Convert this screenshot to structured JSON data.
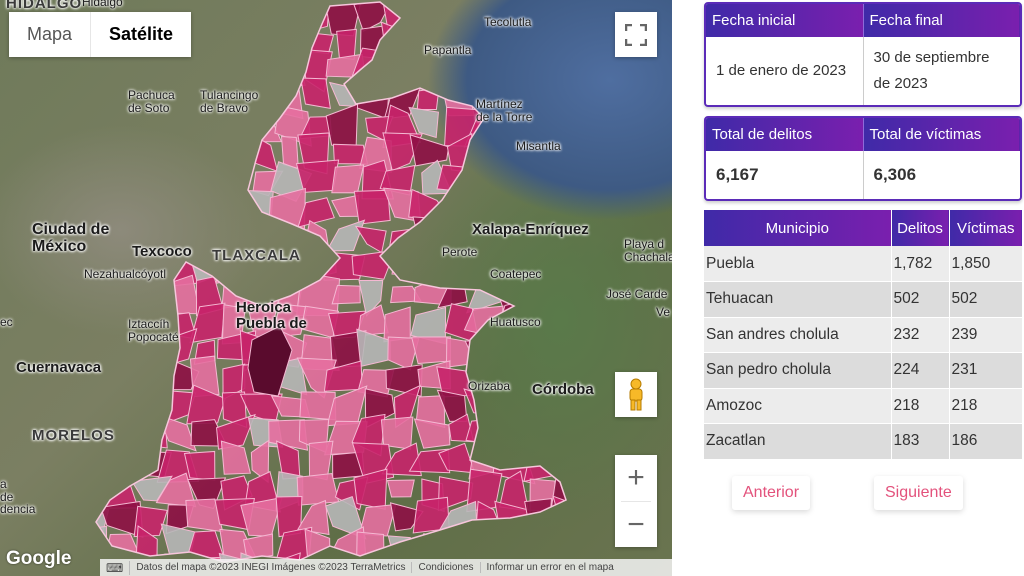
{
  "map": {
    "type_buttons": {
      "map": "Mapa",
      "satellite": "Satélite"
    },
    "labels": [
      {
        "text": "Hidalgo",
        "cls": ""
      },
      {
        "text": "HIDALGO",
        "cls": "state"
      },
      {
        "text": "Tecolutla",
        "cls": ""
      },
      {
        "text": "Papantla",
        "cls": ""
      },
      {
        "text": "Pachuca\nde Soto",
        "cls": ""
      },
      {
        "text": "Tulancingo\nde Bravo",
        "cls": ""
      },
      {
        "text": "Martínez\nde la Torre",
        "cls": ""
      },
      {
        "text": "Misantla",
        "cls": ""
      },
      {
        "text": "Ciudad de\nMéxico",
        "cls": "big"
      },
      {
        "text": "Texcoco",
        "cls": "city"
      },
      {
        "text": "TLAXCALA",
        "cls": "state"
      },
      {
        "text": "Xalapa-Enríquez",
        "cls": "city"
      },
      {
        "text": "Playa d\nChachalac",
        "cls": ""
      },
      {
        "text": "Perote",
        "cls": ""
      },
      {
        "text": "Nezahualcóyotl",
        "cls": ""
      },
      {
        "text": "Coatepec",
        "cls": ""
      },
      {
        "text": "José Carde",
        "cls": ""
      },
      {
        "text": "Heroica\nPuebla de",
        "cls": "city"
      },
      {
        "text": "Iztaccíh\nPopocaté",
        "cls": ""
      },
      {
        "text": "Huatusco",
        "cls": ""
      },
      {
        "text": "Ve",
        "cls": ""
      },
      {
        "text": "ec",
        "cls": ""
      },
      {
        "text": "Cuernavaca",
        "cls": "city"
      },
      {
        "text": "Orizaba",
        "cls": ""
      },
      {
        "text": "Córdoba",
        "cls": "city"
      },
      {
        "text": "MORELOS",
        "cls": "state"
      },
      {
        "text": "a\nde\ndencia",
        "cls": ""
      }
    ],
    "attribution": {
      "data": "Datos del mapa ©2023 INEGI Imágenes ©2023 TerraMetrics",
      "conditions": "Condiciones",
      "report": "Informar un error en el mapa"
    },
    "logo": "Google",
    "zoom_in": "+",
    "zoom_out": "−",
    "colors": {
      "fill_light": "#e66fa0",
      "fill_mid": "#c8246a",
      "fill_dark": "#8e0f45",
      "no_data": "#b7b7b7",
      "border": "#f4b8d2"
    }
  },
  "dates": {
    "headers": [
      "Fecha inicial",
      "Fecha final"
    ],
    "values": [
      "1 de enero de 2023",
      "30 de septiembre de 2023"
    ]
  },
  "totals": {
    "headers": [
      "Total de delitos",
      "Total de víctimas"
    ],
    "values": [
      "6,167",
      "6,306"
    ]
  },
  "municipios": {
    "headers": [
      "Municipio",
      "Delitos",
      "Víctimas"
    ],
    "rows": [
      [
        "Puebla",
        "1,782",
        "1,850"
      ],
      [
        "Tehuacan",
        "502",
        "502"
      ],
      [
        "San andres cholula",
        "232",
        "239"
      ],
      [
        "San pedro cholula",
        "224",
        "231"
      ],
      [
        "Amozoc",
        "218",
        "218"
      ],
      [
        "Zacatlan",
        "183",
        "186"
      ]
    ]
  },
  "pager": {
    "prev": "Anterior",
    "next": "Siguiente"
  },
  "accent": {
    "header_start": "#3f2aa8",
    "header_end": "#7a1fae",
    "link": "#e3527c"
  }
}
